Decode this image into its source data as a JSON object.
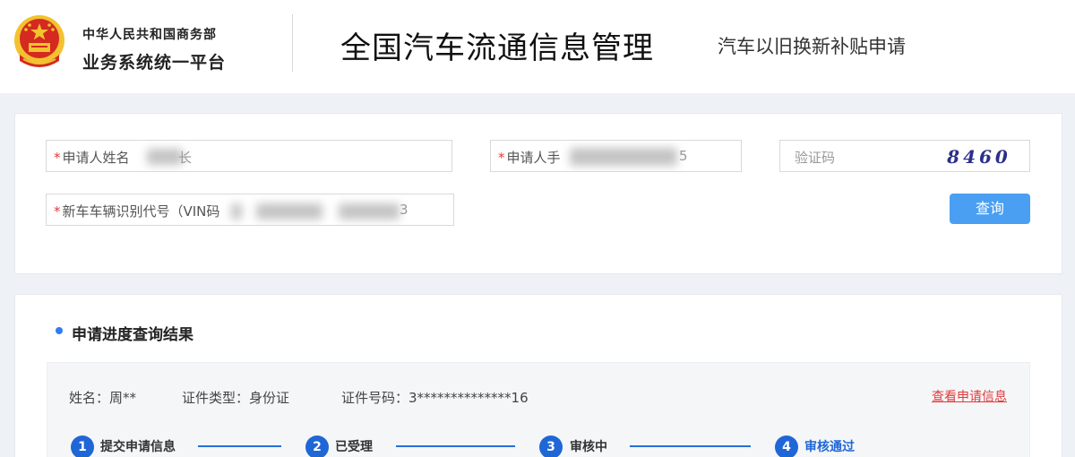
{
  "header": {
    "org_line1": "中华人民共和国商务部",
    "org_line2": "业务系统统一平台",
    "title": "全国汽车流通信息管理",
    "subtitle": "汽车以旧换新补贴申请"
  },
  "search_form": {
    "applicant_name_label": "申请人姓名",
    "applicant_name_value": "长",
    "applicant_phone_label": "申请人手",
    "applicant_phone_value": "5",
    "captcha_placeholder": "验证码",
    "captcha_text": "8460",
    "vin_label": "新车车辆识别代号（VIN码",
    "vin_value": "3",
    "required_mark": "*",
    "query_button": "查询"
  },
  "result": {
    "section_title": "申请进度查询结果",
    "name": "姓名：周**",
    "id_type": "证件类型：身份证",
    "id_number": "证件号码：3**************16",
    "view_link": "查看申请信息",
    "steps": [
      {
        "number": "1",
        "label": "提交申请信息"
      },
      {
        "number": "2",
        "label": "已受理"
      },
      {
        "number": "3",
        "label": "审核中"
      },
      {
        "number": "4",
        "label": "审核通过"
      }
    ]
  },
  "colors": {
    "primary": "#1f67d6",
    "button": "#4a9ff2",
    "required": "#e23b3b",
    "emblem_red": "#d42a1f",
    "emblem_gold": "#f2c230"
  }
}
